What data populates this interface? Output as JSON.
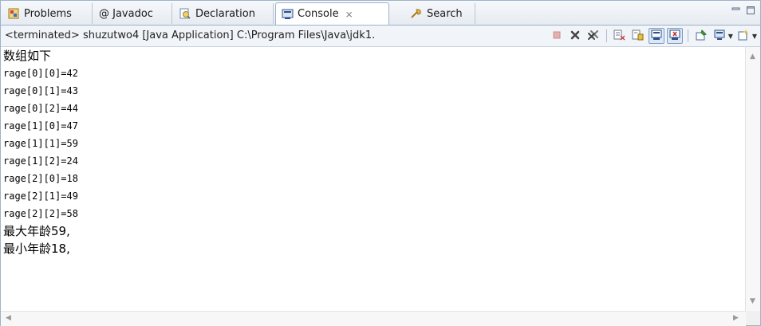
{
  "tabs": [
    {
      "label": "Problems",
      "icon": "problems-icon",
      "active": false
    },
    {
      "label": "@ Javadoc",
      "icon": "",
      "active": false
    },
    {
      "label": "Declaration",
      "icon": "declaration-icon",
      "active": false
    },
    {
      "label": "Console",
      "icon": "console-icon",
      "active": true,
      "close": "⨯"
    },
    {
      "label": "Search",
      "icon": "search-icon",
      "active": false
    }
  ],
  "status": "<terminated> shuzutwo4 [Java Application] C:\\Program Files\\Java\\jdk1.",
  "console_lines": [
    "数组如下",
    "rage[0][0]=42",
    "rage[0][1]=43",
    "rage[0][2]=44",
    "rage[1][0]=47",
    "rage[1][1]=59",
    "rage[1][2]=24",
    "rage[2][0]=18",
    "rage[2][1]=49",
    "rage[2][2]=58",
    "最大年龄59,",
    "最小年龄18,"
  ],
  "colors": {
    "border": "#9eb2c8",
    "terminate_red": "#d9a0a0",
    "pressed_bg": "#dce8f6"
  }
}
